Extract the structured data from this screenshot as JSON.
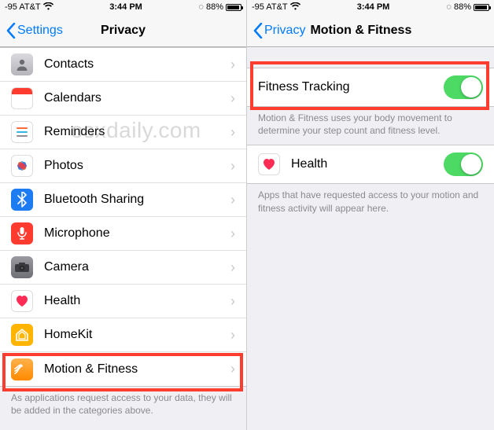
{
  "status": {
    "signal": "●●●○○",
    "carrier": "-95 AT&T",
    "wifi": "wifi",
    "time": "3:44 PM",
    "batt_pct": "88%",
    "batt_icon": "battery"
  },
  "left": {
    "back_label": "Settings",
    "title": "Privacy",
    "items": [
      {
        "label": "Contacts",
        "icon": "contacts"
      },
      {
        "label": "Calendars",
        "icon": "calendars"
      },
      {
        "label": "Reminders",
        "icon": "reminders"
      },
      {
        "label": "Photos",
        "icon": "photos"
      },
      {
        "label": "Bluetooth Sharing",
        "icon": "bluetooth"
      },
      {
        "label": "Microphone",
        "icon": "microphone"
      },
      {
        "label": "Camera",
        "icon": "camera"
      },
      {
        "label": "Health",
        "icon": "health"
      },
      {
        "label": "HomeKit",
        "icon": "homekit"
      },
      {
        "label": "Motion & Fitness",
        "icon": "motion"
      }
    ],
    "footer": "As applications request access to your data, they will be added in the categories above.",
    "highlight_index": 9
  },
  "right": {
    "back_label": "Privacy",
    "title": "Motion & Fitness",
    "fitness_row": {
      "label": "Fitness Tracking",
      "on": true
    },
    "fitness_footer": "Motion & Fitness uses your body movement to determine your step count and fitness level.",
    "health_row": {
      "label": "Health",
      "on": true
    },
    "health_footer": "Apps that have requested access to your motion and fitness activity will appear here.",
    "highlight_row": "fitness"
  },
  "watermark": "osxdaily.com"
}
